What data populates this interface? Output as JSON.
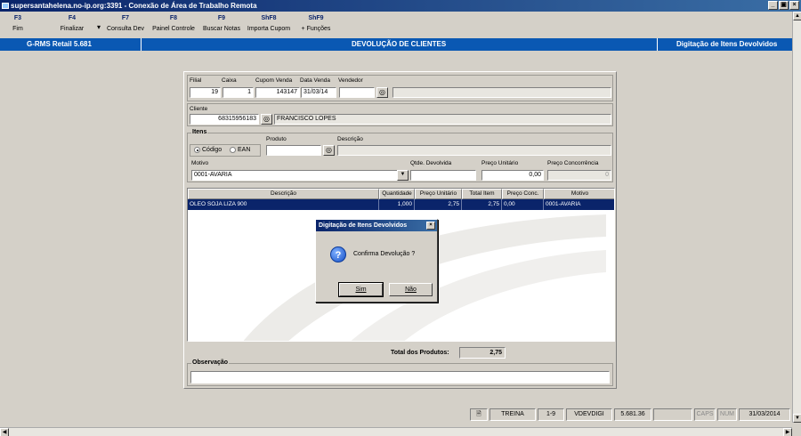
{
  "window": {
    "title": "supersantahelena.no-ip.org:3391 - Conexão de Área de Trabalho Remota",
    "controls": [
      "_",
      "0",
      "X"
    ]
  },
  "toolbar": [
    {
      "key": "F3",
      "label": "Fim"
    },
    {
      "key": "F4",
      "label": "Finalizar"
    },
    {
      "key": "F7",
      "label": "Consulta Dev"
    },
    {
      "key": "F8",
      "label": "Painel Controle"
    },
    {
      "key": "F9",
      "label": "Buscar Notas"
    },
    {
      "key": "ShF8",
      "label": "Importa Cupom"
    },
    {
      "key": "ShF9",
      "label": "+ Funções"
    }
  ],
  "header": {
    "app": "G-RMS Retail 5.681",
    "screen": "DEVOLUÇÃO DE CLIENTES",
    "step": "Digitação de Itens Devolvidos"
  },
  "form": {
    "labels": {
      "filial": "Filial",
      "caixa": "Caixa",
      "cupom": "Cupom Venda",
      "data": "Data Venda",
      "vendedor": "Vendedor",
      "cliente": "Cliente"
    },
    "values": {
      "filial": "19",
      "caixa": "1",
      "cupom": "143147",
      "data": "31/03/14",
      "vendedor": "",
      "vendedor_nome": "",
      "cliente_codigo": "68315956183",
      "cliente_nome": "FRANCISCO LOPES"
    },
    "itens": {
      "title": "Itens",
      "radio_codigo": "Código",
      "radio_ean": "EAN",
      "selected_mode": "Código",
      "produto_label": "Produto",
      "descricao_label": "Descrição",
      "produto_value": "",
      "descricao_value": "",
      "motivo_label": "Motivo",
      "motivo_value": "0001-AVARIA",
      "qtde_label": "Qtde. Devolvida",
      "qtde_value": "",
      "preco_label": "Preço Unitário",
      "preco_value": "0,00",
      "conc_label": "Preço Concorrência",
      "conc_value": "0"
    }
  },
  "grid": {
    "columns": [
      "Descrição",
      "Quantidade",
      "Preço Unitário",
      "Total Item",
      "Preço Conc.",
      "Motivo"
    ],
    "rows": [
      [
        "OLEO SOJA LIZA 900",
        "1,000",
        "2,75",
        "2,75",
        "0,00",
        "0001-AVARIA"
      ]
    ]
  },
  "totals": {
    "label": "Total dos Produtos:",
    "value": "2,75"
  },
  "observacao": {
    "label": "Observação",
    "value": ""
  },
  "dialog": {
    "title": "Digitação de Itens Devolvidos",
    "message": "Confirma Devolução ?",
    "yes_label": "Sim",
    "no_label": "Não",
    "icon": "question-icon"
  },
  "statusbar": {
    "env": "TREINA",
    "pages": "1-9",
    "program": "VDEVDIGI",
    "version": "5.681.36",
    "caps": "CAPS",
    "num": "NUM",
    "date": "31/03/2014"
  },
  "colors": {
    "title_bar": "#0a246a",
    "header_bar": "#0a58b3",
    "selection": "#0a246a",
    "face": "#d4d0c8"
  }
}
